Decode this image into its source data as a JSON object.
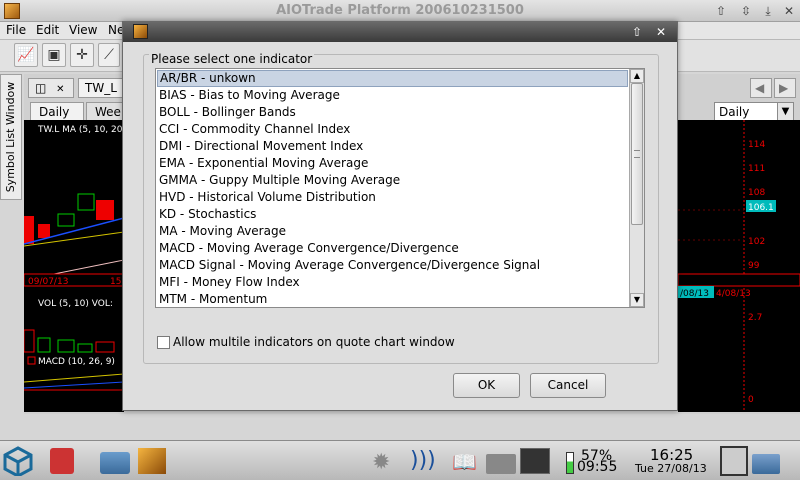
{
  "window": {
    "title": "AIOTrade Platform 200610231500"
  },
  "menu": [
    "File",
    "Edit",
    "View",
    "Ne"
  ],
  "side_tab": "Symbol List Window",
  "doc_tab": "TW_L",
  "period_tabs": [
    "Daily",
    "Wee"
  ],
  "period_select": "Daily",
  "chart": {
    "left_labels": [
      "TW.L MA (5, 10, 20",
      "09/07/13",
      "15",
      "VOL (5, 10)  VOL:",
      "MACD (10, 26, 9)"
    ],
    "right_ticks": [
      "114",
      "111",
      "108",
      "106.1",
      "102",
      "99",
      "/08/13",
      "4/08/13",
      "2.7",
      "0"
    ]
  },
  "dialog": {
    "group_title": "Please select one indicator",
    "items": [
      "AR/BR - unkown",
      "BIAS - Bias to Moving Average",
      "BOLL - Bollinger Bands",
      "CCI - Commodity Channel Index",
      "DMI - Directional Movement Index",
      "EMA - Exponential Moving Average",
      "GMMA - Guppy Multiple Moving Average",
      "HVD - Historical Volume Distribution",
      "KD - Stochastics",
      "MA - Moving Average",
      "MACD - Moving Average Convergence/Divergence",
      "MACD Signal - Moving Average Convergence/Divergence Signal",
      "MFI - Money Flow Index",
      "MTM - Momentum"
    ],
    "selected_index": 0,
    "checkbox_label": "Allow multile indicators on quote chart window",
    "checkbox_checked": false,
    "ok_label": "OK",
    "cancel_label": "Cancel"
  },
  "taskbar": {
    "battery": "57%",
    "battery_time": "09:55",
    "time": "16:25",
    "date": "Tue 27/08/13"
  }
}
